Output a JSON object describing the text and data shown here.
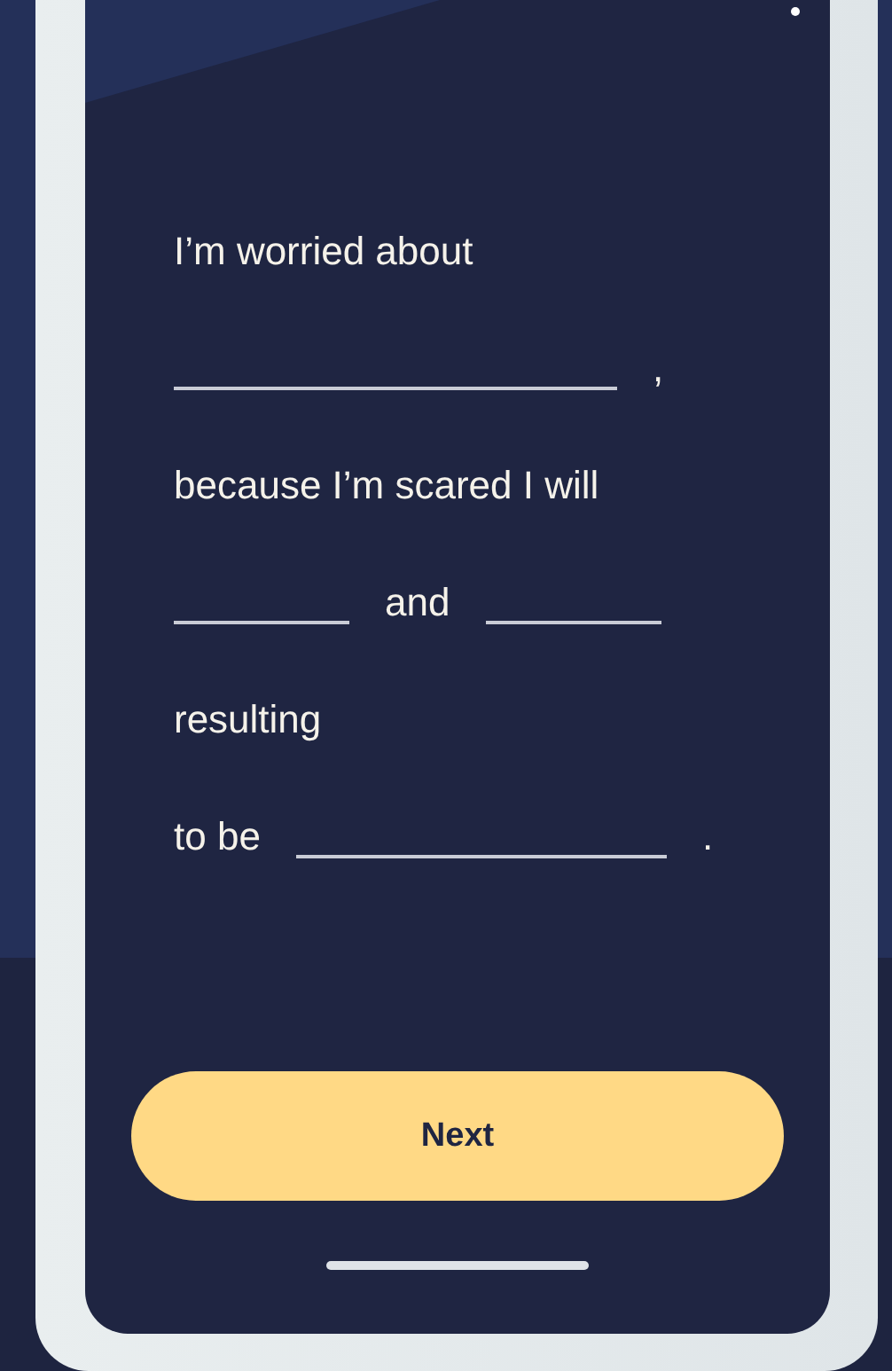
{
  "top_bar": {
    "dot": true
  },
  "prompt": [
    {
      "segments": [
        {
          "kind": "text",
          "text": "I’m worried about"
        }
      ]
    },
    {
      "segments": [
        {
          "kind": "long_blank"
        },
        {
          "kind": "text",
          "text": ","
        }
      ]
    },
    {
      "segments": [
        {
          "kind": "text",
          "text": "because I’m scared I will"
        }
      ]
    },
    {
      "segments": [
        {
          "kind": "short_blank"
        },
        {
          "kind": "text",
          "text": "and"
        },
        {
          "kind": "short_blank"
        }
      ]
    },
    {
      "segments": [
        {
          "kind": "text",
          "text": "resulting"
        }
      ]
    },
    {
      "segments": [
        {
          "kind": "text",
          "text": "to be"
        },
        {
          "kind": "medium_blank"
        },
        {
          "kind": "text",
          "text": "."
        }
      ]
    }
  ],
  "next_button": {
    "label": "Next"
  }
}
